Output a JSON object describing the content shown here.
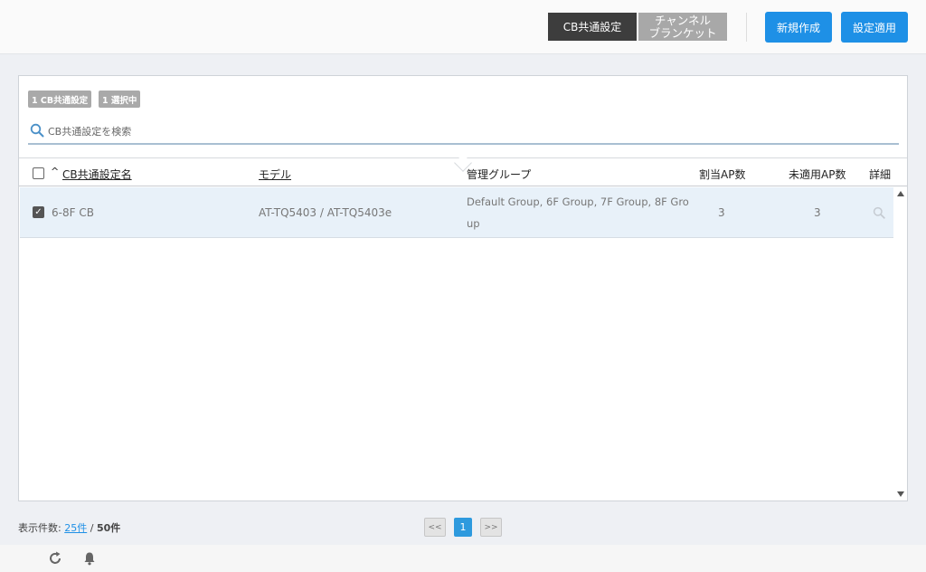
{
  "header": {
    "tab_active": "CB共通設定",
    "tab_inactive_line1": "チャンネル",
    "tab_inactive_line2": "ブランケット",
    "new_button": "新規作成",
    "apply_button": "設定適用"
  },
  "chips": {
    "count_chip": "1 CB共通設定",
    "selected_chip": "1 選択中"
  },
  "search": {
    "placeholder": "CB共通設定を検索"
  },
  "table": {
    "sort_indicator": "^",
    "columns": {
      "name": "CB共通設定名",
      "model": "モデル",
      "group": "管理グループ",
      "assigned": "割当AP数",
      "unapplied": "未適用AP数",
      "detail": "詳細"
    },
    "rows": [
      {
        "selected": true,
        "name": "6-8F CB",
        "model": "AT-TQ5403 / AT-TQ5403e",
        "group_line1": "Default Group, 6F Group, 7F Group, 8F Gro",
        "group_line2": "up",
        "assigned": "3",
        "unapplied": "3"
      }
    ]
  },
  "footer": {
    "display_label": "表示件数:",
    "per_page": "25件",
    "separator": "/",
    "total": "50件",
    "prev": "<<",
    "page": "1",
    "next": ">>"
  },
  "colors": {
    "accent": "#1e90e6",
    "tab_active": "#3d3d3d",
    "tab_inactive": "#a8a8a8",
    "row_selected": "#e8f1f9"
  },
  "icons": {
    "search": "search-icon",
    "row_detail": "magnifier-icon",
    "refresh": "refresh-icon",
    "bell": "bell-icon"
  }
}
